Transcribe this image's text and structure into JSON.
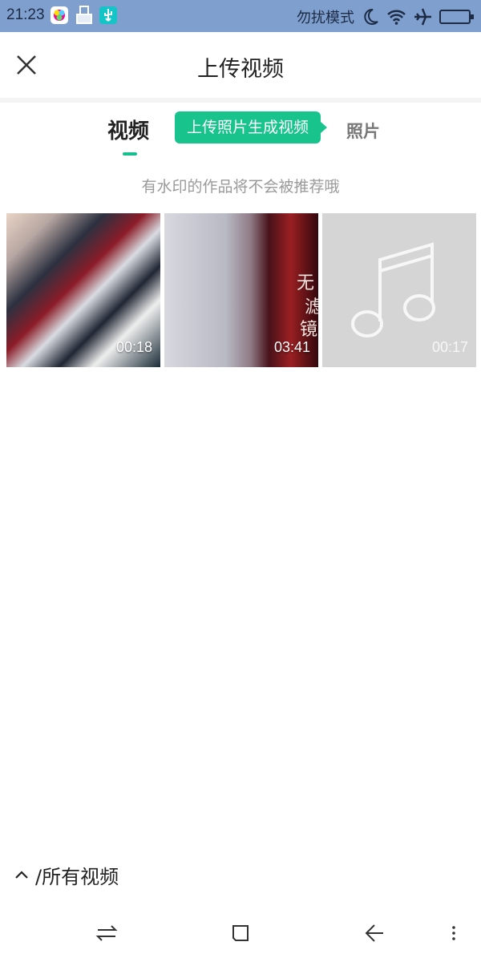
{
  "status_bar": {
    "time": "21:23",
    "dnd_label": "勿扰模式",
    "icons": [
      "gallery-app-icon",
      "clean-app-icon",
      "usb-icon",
      "moon-icon",
      "wifi-icon",
      "airplane-icon",
      "battery-icon"
    ]
  },
  "top_bar": {
    "title": "上传视频"
  },
  "tabs": {
    "video": "视频",
    "photo": "照片",
    "tip": "上传照片生成视频"
  },
  "hint": "有水印的作品将不会被推荐哦",
  "videos": [
    {
      "duration": "00:18"
    },
    {
      "duration": "03:41",
      "overlay_text": [
        "无",
        "滤",
        "镜"
      ]
    },
    {
      "duration": "00:17"
    }
  ],
  "album": {
    "label": "/所有视频"
  },
  "nav": {
    "icons": [
      "switch-icon",
      "home-icon",
      "back-icon",
      "menu-icon"
    ]
  },
  "colors": {
    "status_bar": "#7f9fcf",
    "accent": "#16c08c",
    "hint_text": "#9a9a9a",
    "placeholder": "#d5d5d5"
  }
}
